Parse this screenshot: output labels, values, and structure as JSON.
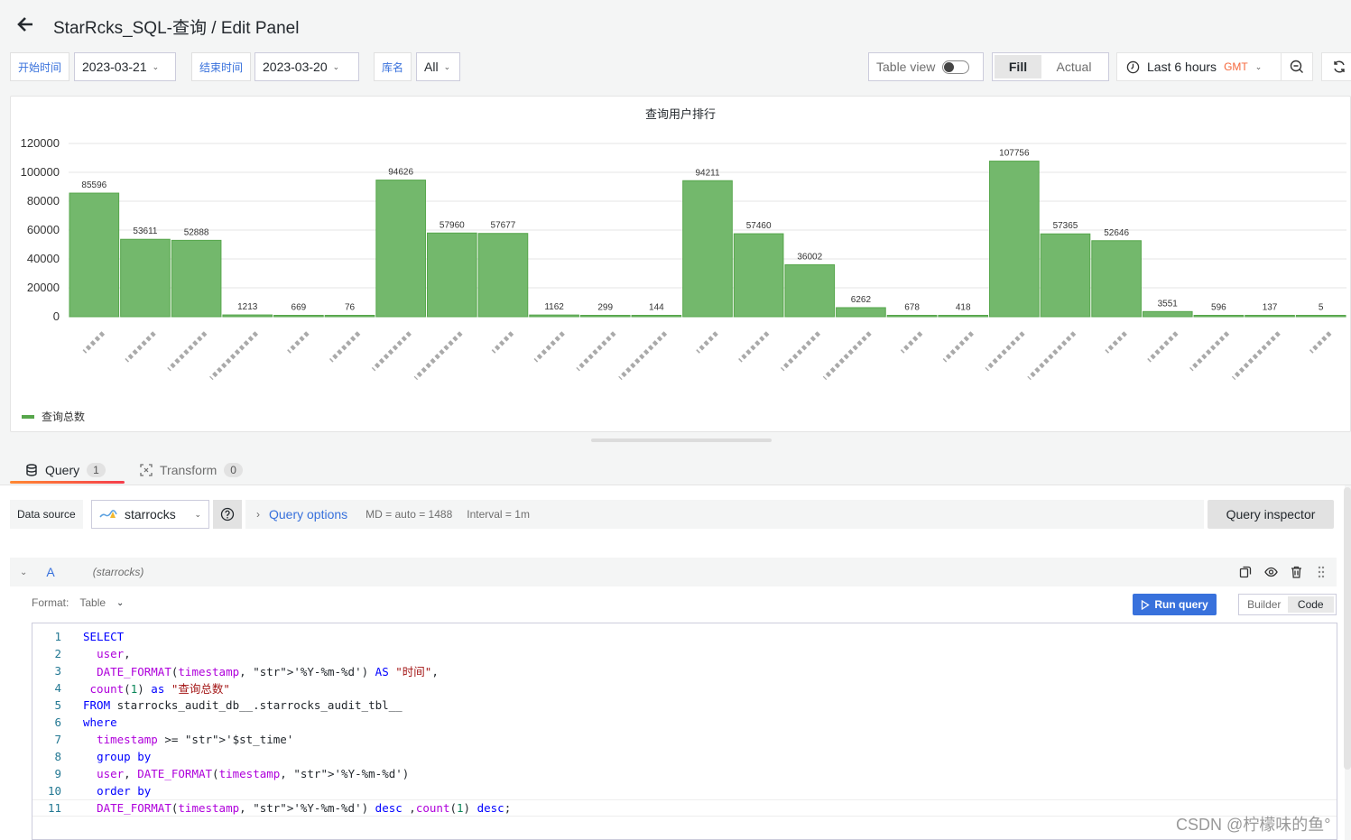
{
  "header": {
    "title": "StarRcks_SQL-查询 / Edit Panel",
    "back_icon": "arrow-left-icon"
  },
  "variables": [
    {
      "label": "开始时间",
      "value": "2023-03-21"
    },
    {
      "label": "结束时间",
      "value": "2023-03-20"
    },
    {
      "label": "库名",
      "value": "All"
    }
  ],
  "toolbar": {
    "table_view_label": "Table view",
    "table_view_on": false,
    "fill_label": "Fill",
    "actual_label": "Actual",
    "time_range": "Last 6 hours",
    "timezone": "GMT",
    "zoom_out_icon": "zoom-out-icon",
    "refresh_icon": "refresh-icon"
  },
  "chart_data": {
    "type": "bar",
    "title": "查询用户排行",
    "xlabel": "",
    "ylabel": "",
    "ylim": [
      0,
      120000
    ],
    "yticks": [
      0,
      20000,
      40000,
      60000,
      80000,
      100000,
      120000
    ],
    "grid": true,
    "legend_position": "bottom-left",
    "categories_obscured": true,
    "series": [
      {
        "name": "查询总数",
        "color": "#73b86c",
        "values": [
          85596,
          53611,
          52888,
          1213,
          669,
          76,
          94626,
          57960,
          57677,
          1162,
          299,
          144,
          94211,
          57460,
          36002,
          6262,
          678,
          418,
          107756,
          57365,
          52646,
          3551,
          596,
          137,
          5
        ]
      }
    ]
  },
  "tabs": [
    {
      "label": "Query",
      "count": "1",
      "active": true
    },
    {
      "label": "Transform",
      "count": "0",
      "active": false
    }
  ],
  "query": {
    "data_source_label": "Data source",
    "data_source": "starrocks",
    "options_label": "Query options",
    "md_info": "MD = auto = 1488",
    "interval_info": "Interval = 1m",
    "inspector_label": "Query inspector",
    "ref_id": "A",
    "ref_source": "(starrocks)",
    "format_label": "Format:",
    "format_value": "Table",
    "run_label": "Run query",
    "builder_label": "Builder",
    "code_label": "Code"
  },
  "sql_lines": [
    "SELECT",
    "  user,",
    "  DATE_FORMAT(timestamp, '%Y-%m-%d') AS \"时间\",",
    " count(1) as \"查询总数\"",
    "FROM starrocks_audit_db__.starrocks_audit_tbl__",
    "where",
    "  timestamp >= '$st_time'",
    "  group by",
    "  user, DATE_FORMAT(timestamp, '%Y-%m-%d')",
    "  order by",
    "  DATE_FORMAT(timestamp, '%Y-%m-%d') desc ,count(1) desc;"
  ],
  "watermark": "CSDN @柠檬味的鱼°"
}
